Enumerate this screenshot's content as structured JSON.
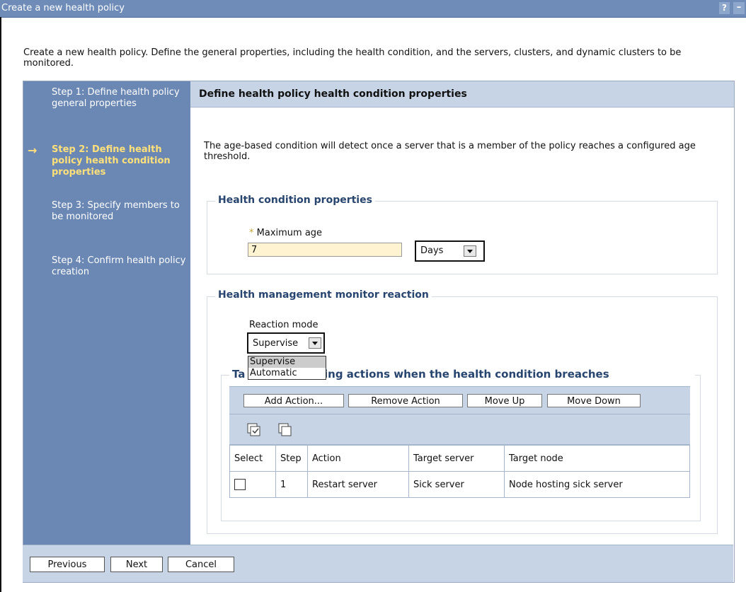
{
  "window": {
    "title": "Create a new health policy",
    "help_label": "?",
    "minimize_label": "–"
  },
  "intro": "Create a new health policy. Define the general properties, including the health condition, and the servers, clusters, and dynamic clusters to be monitored.",
  "steps": [
    {
      "label": "Step 1: Define health policy general properties"
    },
    {
      "label": "Step 2: Define health policy health condition properties",
      "active": true
    },
    {
      "label": "Step 3: Specify members to be monitored"
    },
    {
      "label": "Step 4: Confirm health policy creation"
    }
  ],
  "content": {
    "header": "Define health policy health condition properties",
    "description": "The age-based condition will detect once a server that is a member of the policy reaches a configured age threshold.",
    "health_condition": {
      "legend": "Health condition properties",
      "required_marker": "*",
      "max_age_label": "Maximum age",
      "max_age_value": "7",
      "unit_value": "Days"
    },
    "monitor_reaction": {
      "legend": "Health management monitor reaction",
      "reaction_mode_label": "Reaction mode",
      "reaction_mode_value": "Supervise",
      "options": [
        "Supervise",
        "Automatic"
      ],
      "actions_legend_left": "Ta",
      "actions_legend_right": "ing actions when the health condition breaches",
      "buttons": {
        "add": "Add Action...",
        "remove": "Remove Action",
        "up": "Move Up",
        "down": "Move Down"
      },
      "table": {
        "headers": [
          "Select",
          "Step",
          "Action",
          "Target server",
          "Target node"
        ],
        "rows": [
          [
            "",
            "1",
            "Restart server",
            "Sick server",
            "Node hosting sick server"
          ]
        ]
      }
    }
  },
  "footer": {
    "previous": "Previous",
    "next": "Next",
    "cancel": "Cancel"
  }
}
